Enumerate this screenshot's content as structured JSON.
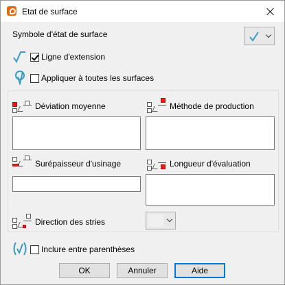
{
  "window": {
    "title": "Etat de surface"
  },
  "symbol": {
    "label": "Symbole d'état de surface",
    "selected_icon": "surface-check-symbol"
  },
  "options": {
    "extension_line": {
      "label": "Ligne d'extension",
      "checked": true
    },
    "apply_all": {
      "label": "Appliquer à toutes les surfaces",
      "checked": false
    },
    "parentheses": {
      "label": "Inclure entre parenthèses",
      "checked": false
    }
  },
  "fields": {
    "deviation": {
      "label": "Déviation moyenne",
      "value": ""
    },
    "production": {
      "label": "Méthode de production",
      "value": ""
    },
    "allowance": {
      "label": "Surépaisseur d'usinage",
      "value": ""
    },
    "evaluation": {
      "label": "Longueur d'évaluation",
      "value": ""
    },
    "lay": {
      "label": "Direction des stries",
      "value": ""
    }
  },
  "buttons": {
    "ok": "OK",
    "cancel": "Annuler",
    "help": "Aide"
  },
  "colors": {
    "accent": "#0078d7",
    "symbol_teal": "#3a9bbf",
    "marker_red": "#e01e1e"
  }
}
